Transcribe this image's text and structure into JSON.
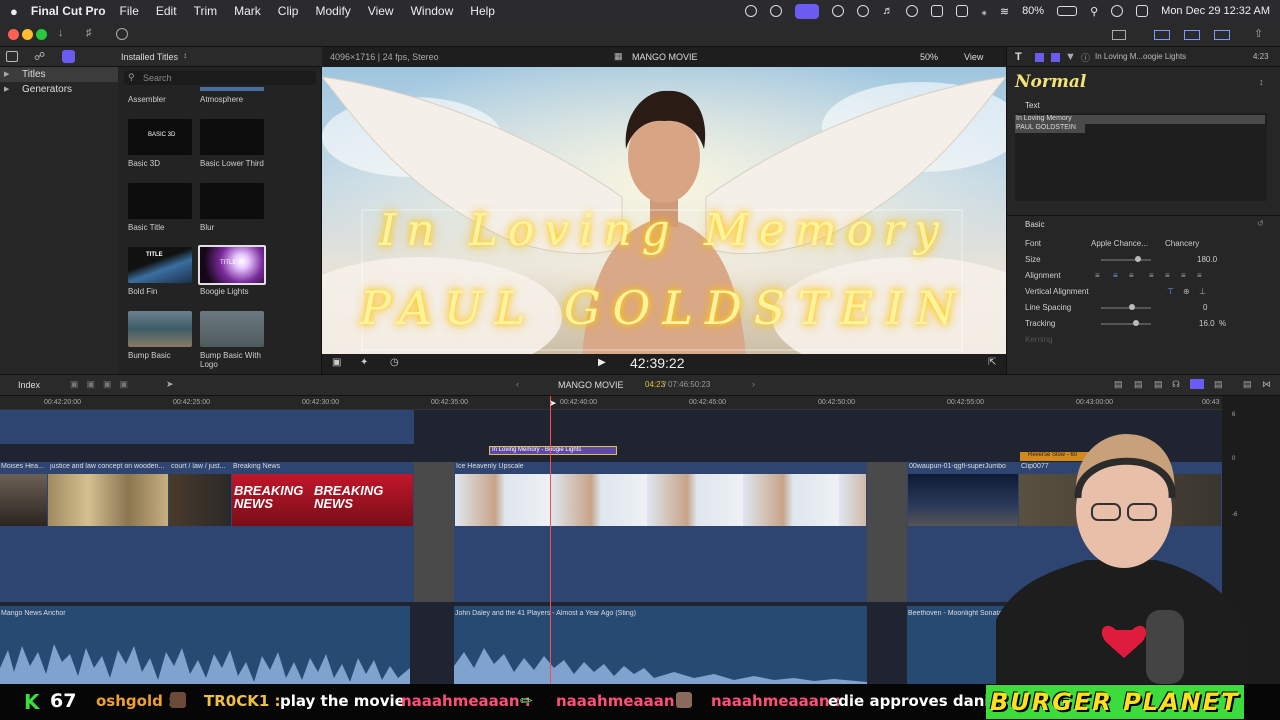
{
  "menubar": {
    "app": "Final Cut Pro",
    "items": [
      "File",
      "Edit",
      "Trim",
      "Mark",
      "Clip",
      "Modify",
      "View",
      "Window",
      "Help"
    ],
    "battery": "80%",
    "datetime": "Mon Dec 29  12:32 AM"
  },
  "browser": {
    "header": "Installed Titles",
    "search_placeholder": "Search",
    "library_items": [
      "Titles",
      "Generators"
    ],
    "thumbs": [
      {
        "label": "Assembler",
        "thumb_text": ""
      },
      {
        "label": "Atmosphere",
        "thumb_text": ""
      },
      {
        "label": "Basic 3D",
        "thumb_text": "BASIC 3D"
      },
      {
        "label": "Basic Lower Third",
        "thumb_text": ""
      },
      {
        "label": "Basic Title",
        "thumb_text": ""
      },
      {
        "label": "Blur",
        "thumb_text": ""
      },
      {
        "label": "Bold Fin",
        "thumb_text": "TITLE"
      },
      {
        "label": "Boogie Lights",
        "thumb_text": "TITLE"
      },
      {
        "label": "Bump Basic",
        "thumb_text": ""
      },
      {
        "label": "Bump Basic With Logo",
        "thumb_text": ""
      }
    ]
  },
  "viewer": {
    "format": "4096×1716 | 24 fps, Stereo",
    "project": "MANGO MOVIE",
    "zoom": "50%",
    "view_label": "View",
    "title_line1": "In Loving Memory",
    "title_line2": "PAUL GOLDSTEIN",
    "timecode": "42:39:22"
  },
  "inspector": {
    "clip_title": "In Loving M...oogie Lights",
    "duration": "4:23",
    "preset": "Normal",
    "text_section": "Text",
    "text_line1": "In Loving Memory",
    "text_line2": "PAUL GOLDSTEIN",
    "basic_section": "Basic",
    "font_label": "Font",
    "font_value": "Apple Chance...",
    "font_style": "Chancery",
    "size_label": "Size",
    "size_value": "180.0",
    "alignment_label": "Alignment",
    "valign_label": "Vertical Alignment",
    "line_spacing_label": "Line Spacing",
    "line_spacing_value": "0",
    "tracking_label": "Tracking",
    "tracking_value": "16.0",
    "tracking_unit": "%",
    "kerning_label": "Kerning"
  },
  "timeline": {
    "index_label": "Index",
    "project": "MANGO MOVIE",
    "position": "04:23",
    "total": "07:46:50:23",
    "ruler": [
      "00:42:20:00",
      "00:42:25:00",
      "00:42:30:00",
      "00:42:35:00",
      "00:42:40:00",
      "00:42:45:00",
      "00:42:50:00",
      "00:42:55:00",
      "00:43:00:00",
      "00:43"
    ],
    "title_clip": "In Loving Memory - Boogie Lights",
    "reverse_clip": "Reverse Slow - 60",
    "clips": [
      {
        "name": "Moises Hea..."
      },
      {
        "name": "justice and law concept on wooden..."
      },
      {
        "name": "court / law / just..."
      },
      {
        "name": "Breaking News"
      },
      {
        "name": "Ice Heavenly Upscale"
      },
      {
        "name": "00waupun-01-qgfl-superJumbo"
      },
      {
        "name": "Clip0077"
      }
    ],
    "breaking_text": "BREAKING NEWS",
    "audio": [
      {
        "name": "Mango News Anchor"
      },
      {
        "name": "John Daley and the 41 Players - Almost a Year Ago (Sting)"
      },
      {
        "name": "Beethoven - Moonlight Sonata (by Be..."
      }
    ],
    "meter_labels": [
      "6",
      "0",
      "-6"
    ]
  },
  "chat": {
    "count": "67",
    "messages": [
      {
        "user": "oshgold :",
        "text": "",
        "user_color": "#f0a030"
      },
      {
        "user": "TR0CK1 :",
        "text": "play the movie",
        "user_color": "#f0c040"
      },
      {
        "user": "naaahmeaaan :",
        "text": "",
        "user_color": "#ff4f79"
      },
      {
        "user": "naaahmeaaan :",
        "text": "",
        "user_color": "#ff4f79"
      },
      {
        "user": "naaahmeaaan :",
        "text": "edie approves dani",
        "user_color": "#ff4f79"
      }
    ],
    "brand": "BURGER PLANET"
  }
}
